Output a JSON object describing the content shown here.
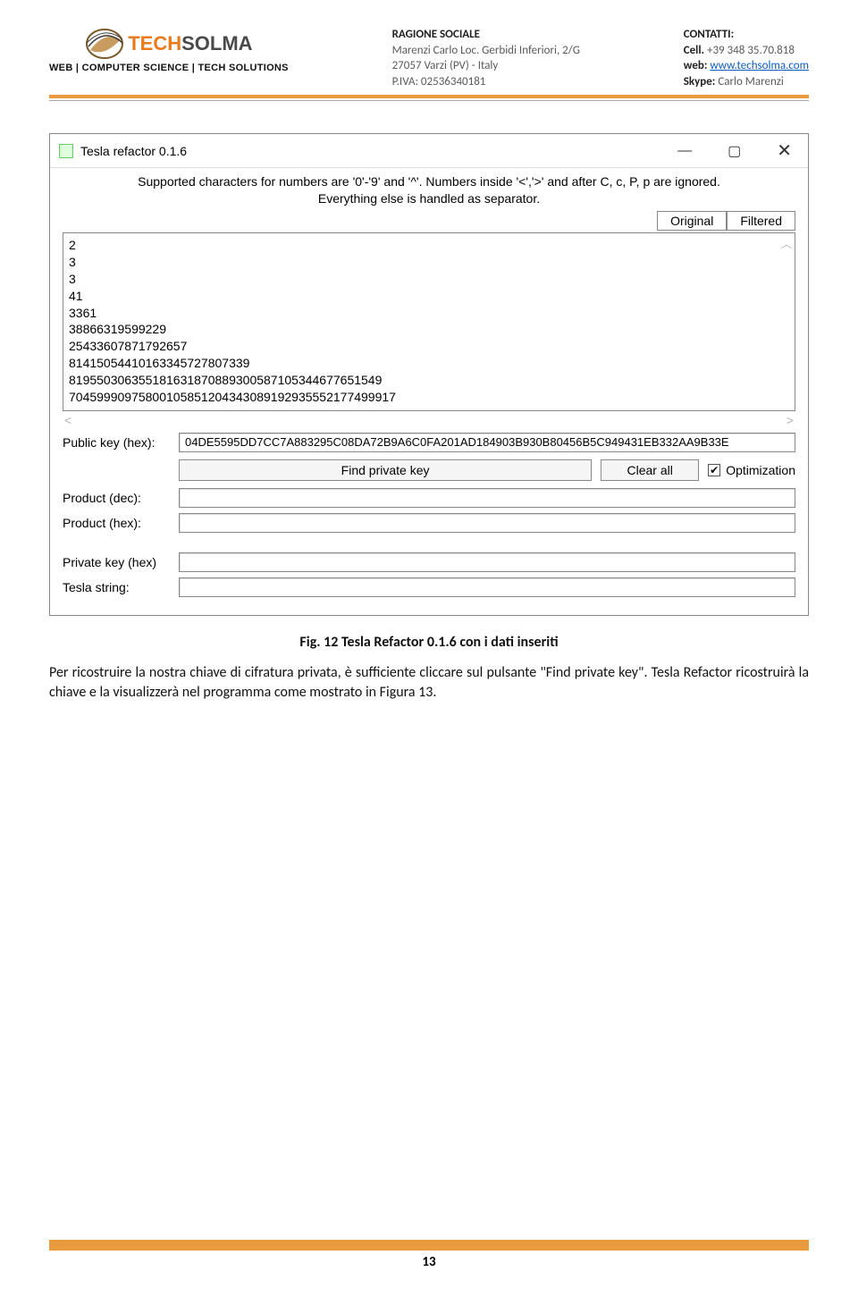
{
  "header": {
    "brand_tech": "TECH",
    "brand_solma": "SOLMA",
    "tagline": "WEB | COMPUTER SCIENCE | TECH SOLUTIONS",
    "ragione_label": "RAGIONE SOCIALE",
    "ragione_line1": "Marenzi Carlo  Loc. Gerbidi Inferiori, 2/G",
    "ragione_line2": "27057 Varzi (PV) - Italy",
    "piva_label": "P.IVA:",
    "piva_val": " 02536340181",
    "contatti_label": "CONTATTI:",
    "cell_label": "Cell.",
    "cell_val": " +39 348 35.70.818",
    "web_label": "web:",
    "web_link": "www.techsolma.com",
    "skype_label": "Skype:",
    "skype_val": " Carlo Marenzi"
  },
  "app": {
    "title": "Tesla refactor 0.1.6",
    "supported": "Supported characters for numbers are '0'-'9' and '^'. Numbers inside '<','>' and after C, c, P, p are ignored. Everything else is handled as separator.",
    "tab_original": "Original",
    "tab_filtered": "Filtered",
    "numbers": "2\n3\n3\n41\n3361\n38866319599229\n25433607871792657\n8141505441016334572780733­9\n81955030635518163187088930058710534467765154­9\n704599909758001058512043430891929355521774999­17",
    "numbers_plain": "2\n3\n3\n41\n3361\n38866319599229\n25433607871792657\n81415054410163345727807339\n819550306355181631870889300587105344677651549\n704599909758001058512043430891929355521774999­17",
    "pubkey_label": "Public key (hex):",
    "pubkey_value": "04DE5595DD7CC7A883295C08DA72B9A6C0FA201AD184903B930B80456B5C949431EB332AA9B33E",
    "btn_find": "Find private key",
    "btn_clear": "Clear all",
    "chk_opt": "Optimization",
    "prod_dec_label": "Product (dec):",
    "prod_hex_label": "Product (hex):",
    "privkey_label": "Private key (hex)",
    "tesla_label": "Tesla string:"
  },
  "caption": "Fig. 12 Tesla Refactor 0.1.6 con i dati inseriti",
  "paragraph": "Per ricostruire  la nostra chiave di cifratura privata, è sufficiente cliccare sul pulsante \"Find private key\". Tesla Refactor ricostruirà la chiave e la visualizzerà nel programma come mostrato in Figura 13.",
  "page_number": "13"
}
